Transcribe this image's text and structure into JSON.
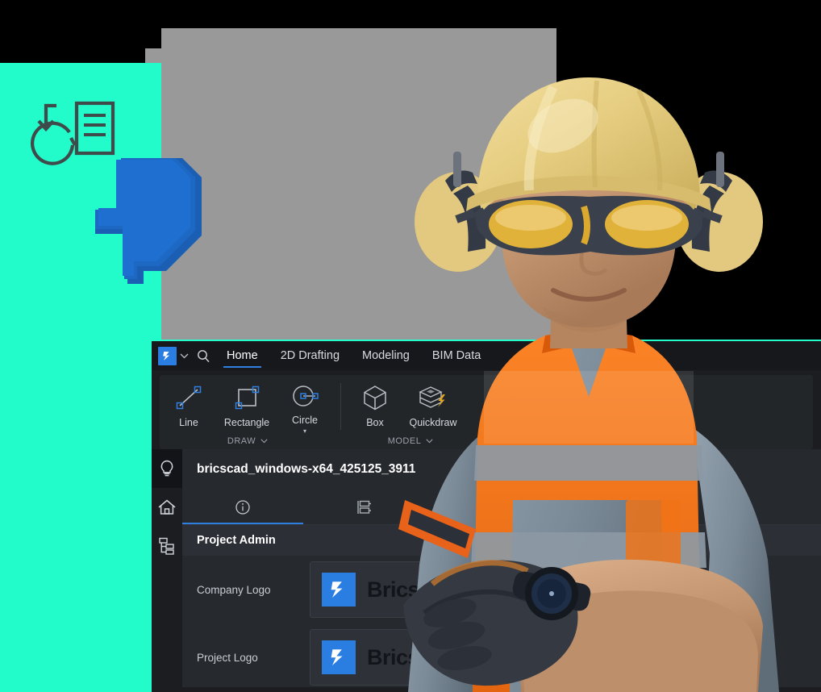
{
  "decor": {
    "teal_color": "#22FBCA",
    "gray_color": "#999999",
    "arrow_color": "#1C68C2",
    "arrow_color_dark": "#1A5FB4",
    "icon_stroke": "#3F4A4A",
    "download_icon_name": "download-document-refresh-icon",
    "arrow_icon_name": "down-arrow-3d-icon"
  },
  "app": {
    "brand_logo_name": "bricscad-logo",
    "accent_blue": "#2a7de1",
    "titlebar": {
      "quick_chevron": "⌄",
      "search_icon": "search-icon"
    },
    "ribbon_tabs": [
      {
        "label": "Home",
        "active": true
      },
      {
        "label": "2D Drafting",
        "active": false
      },
      {
        "label": "Modeling",
        "active": false
      },
      {
        "label": "BIM Data",
        "active": false
      }
    ],
    "ribbon_groups": [
      {
        "title": "DRAW",
        "expander": "⌄",
        "buttons": [
          {
            "label": "Line",
            "icon": "line-tool-icon",
            "has_caret": false
          },
          {
            "label": "Rectangle",
            "icon": "rectangle-tool-icon",
            "has_caret": false
          },
          {
            "label": "Circle",
            "icon": "circle-tool-icon",
            "has_caret": true
          }
        ]
      },
      {
        "title": "MODEL",
        "expander": "⌄",
        "buttons": [
          {
            "label": "Box",
            "icon": "box-tool-icon",
            "has_caret": false
          },
          {
            "label": "Quickdraw",
            "icon": "quickdraw-tool-icon",
            "has_caret": false
          }
        ]
      }
    ],
    "rail": [
      {
        "name": "sidebar-item-lightbulb",
        "icon": "lightbulb-icon",
        "selected": true
      },
      {
        "name": "sidebar-item-home",
        "icon": "home-icon",
        "selected": false
      },
      {
        "name": "sidebar-item-structure",
        "icon": "structure-tree-icon",
        "selected": false
      }
    ],
    "document": {
      "title": "bricscad_windows-x64_425125_3911",
      "tabs": [
        {
          "name": "tab-info",
          "icon": "info-circle-icon",
          "active": true
        },
        {
          "name": "tab-sheets",
          "icon": "sheet-layout-icon",
          "active": false
        }
      ],
      "section_header": "Project Admin",
      "rows": [
        {
          "label": "Company Logo",
          "logo_mark": "bricscad-logo",
          "wordmark": "BricsCAD"
        },
        {
          "label": "Project Logo",
          "logo_mark": "bricscad-logo",
          "wordmark": "BricsCAD"
        }
      ]
    }
  },
  "photo": {
    "subject": "construction-worker-with-hard-hat",
    "helmet_color": "#E8D08A",
    "earmuff_color": "#E6CC87",
    "glasses_lens_color": "#E7B83C",
    "vest_color": "#F4731B",
    "shirt_color": "#7D8C98",
    "glove_color": "#2E323B",
    "skin_color": "#C99A77"
  }
}
